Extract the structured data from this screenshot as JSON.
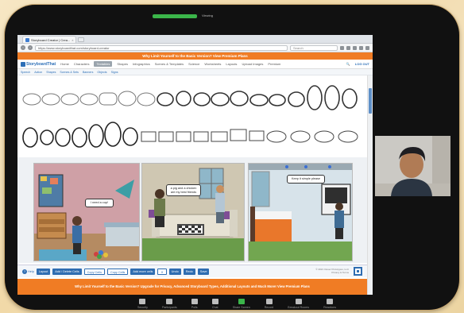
{
  "meeting": {
    "share_status": "Viewing"
  },
  "browser": {
    "tab_title": "Storyboard Creator | Crea...",
    "tab_close": "×",
    "url": "https://www.storyboardthat.com/storyboard-creator",
    "search_placeholder": "Search"
  },
  "app": {
    "upgrade_banner": "Why Limit Yourself to the Basic Version? View Premium Plans",
    "logo": "StoryboardThat",
    "nav": [
      "Home",
      "Characters",
      "Textables",
      "Shapes",
      "Infographics",
      "Scenes & Templates",
      "Science",
      "Worksheets",
      "Layouts",
      "Upload Images",
      "Premium"
    ],
    "nav_active_index": 2,
    "login": "LOG OUT",
    "subnav": [
      "Speech",
      "Action",
      "Shapes",
      "Scenes & Sets",
      "Banners",
      "Objects",
      "Signs"
    ]
  },
  "storyboard": {
    "cells": [
      {
        "speech": "I need a cup!"
      },
      {
        "speech": "a pig and a chicken are my best friends"
      },
      {
        "speech": "Keep it simple please"
      }
    ]
  },
  "toolbar": {
    "help": "Help",
    "buttons": [
      "Layout",
      "Add / Delete Cells",
      "Copy Cells",
      "Copy Cells",
      "Add more cells",
      "Undo",
      "Redo",
      "Save"
    ],
    "copyright": "© 2021 Clever Prototypes, LLC",
    "copyright2": "Privacy & Terms"
  },
  "footer": {
    "upgrade": "Why Limit Yourself to the Basic Version? Upgrade for Privacy, Advanced Storyboard Types, Additional Layouts and Much More! View Premium Plans"
  },
  "zoom_bar": {
    "items": [
      {
        "label": "Security",
        "green": false
      },
      {
        "label": "Participants",
        "green": false
      },
      {
        "label": "Polls",
        "green": false
      },
      {
        "label": "Chat",
        "green": false
      },
      {
        "label": "Share Screen",
        "green": true
      },
      {
        "label": "Record",
        "green": false
      },
      {
        "label": "Breakout Rooms",
        "green": false
      },
      {
        "label": "Reactions",
        "green": false
      }
    ]
  },
  "colors": {
    "accent_orange": "#f07c24",
    "accent_blue": "#2f6db1",
    "frame": "#111111"
  }
}
